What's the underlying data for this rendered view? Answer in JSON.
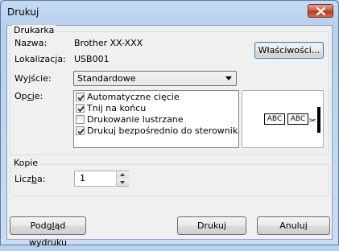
{
  "window": {
    "title": "Drukuj"
  },
  "printer_group": {
    "label": "Drukarka",
    "name_label": "Nazwa:",
    "name_value": "Brother XX-XXX",
    "location_label": "Lokalizacja:",
    "location_value": "USB001",
    "properties_button": "Właściwości...",
    "output_label": "Wyjście:",
    "output_value": "Standardowe",
    "options_label": "Opcje:",
    "options": [
      {
        "label": "Automatyczne cięcie",
        "checked": true
      },
      {
        "label": "Tnij na końcu",
        "checked": true
      },
      {
        "label": "Drukowanie lustrzane",
        "checked": false
      },
      {
        "label": "Drukuj bezpośrednio do sterownika dru",
        "checked": true
      }
    ],
    "preview_labels": [
      "ABC",
      "ABC"
    ]
  },
  "copies_group": {
    "label": "Kopie",
    "count_label": "Liczba:",
    "count_value": "1"
  },
  "buttons": {
    "preview": "Podgląd wydruku",
    "print": "Drukuj",
    "cancel": "Anuluj"
  }
}
